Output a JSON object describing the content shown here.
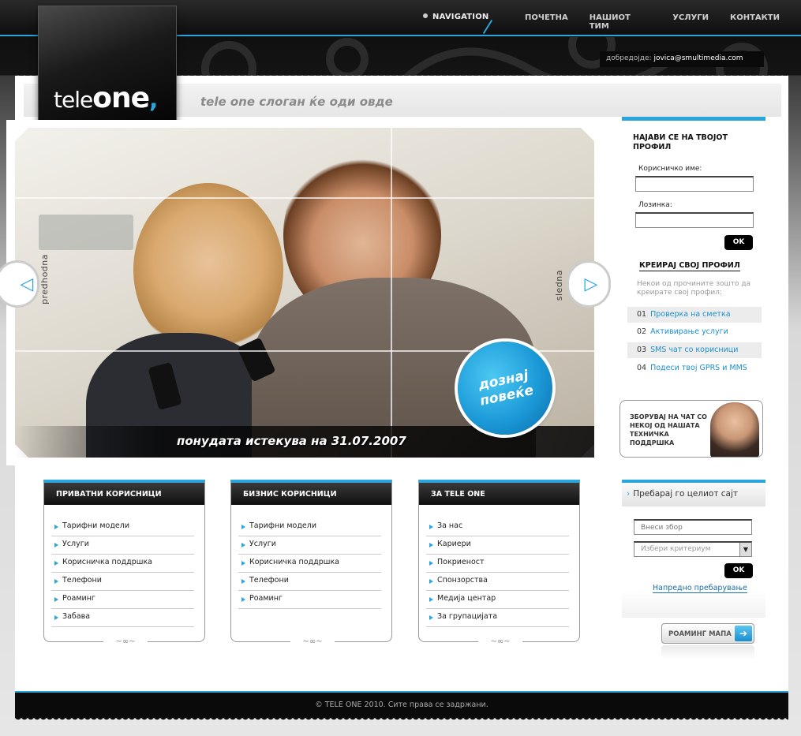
{
  "header": {
    "nav_tag": "NAVIGATION",
    "nav_items": [
      "ПОЧЕТНА",
      "НАШИОТ ТИМ",
      "УСЛУГИ",
      "КОНТАКТИ"
    ],
    "welcome_label": "добредојде:",
    "welcome_user": "jovica@smultimedia.com"
  },
  "logo": {
    "prefix": "tele",
    "main": "one",
    "comma": ","
  },
  "slogan": "tele one слоган ќе оди овде",
  "slider": {
    "prev_label": "predhodna",
    "next_label": "sledna",
    "caption": "понудата истекува на 31.07.2007",
    "badge_line1": "дознај",
    "badge_line2": "повеќе"
  },
  "login": {
    "title": "НАЈАВИ СЕ НА ТВОЈОТ ПРОФИЛ",
    "username_label": "Корисничко име:",
    "password_label": "Лозинка:",
    "ok_label": "OK",
    "create_label": "КРЕИРАЈ СВОЈ ПРОФИЛ",
    "reasons_intro": "Некои од прочините зошто да креирате свој профил:",
    "reasons": [
      {
        "num": "01",
        "text": "Проверка на сметка"
      },
      {
        "num": "02",
        "text": "Активирање услуги"
      },
      {
        "num": "03",
        "text": "SMS чат со корисници"
      },
      {
        "num": "04",
        "text": "Подеси твој GPRS и MMS"
      }
    ]
  },
  "chat": {
    "text": "ЗБОРУВАЈ НА ЧАТ СО НЕКОЈ ОД НАШАТА ТЕХНИЧКА ПОДДРШКА"
  },
  "columns": [
    {
      "title": "ПРИВАТНИ КОРИСНИЦИ",
      "items": [
        "Тарифни модели",
        "Услуги",
        "Корисничка поддршка",
        "Телефони",
        "Роаминг",
        "Забава"
      ]
    },
    {
      "title": "БИЗНИС КОРИСНИЦИ",
      "items": [
        "Тарифни модели",
        "Услуги",
        "Корисничка поддршка",
        "Телефони",
        "Роаминг"
      ]
    },
    {
      "title": "ЗА TELE ONE",
      "items": [
        "За нас",
        "Кариери",
        "Покриеност",
        "Спонзорства",
        "Медија центар",
        "За групацијата"
      ]
    }
  ],
  "search": {
    "title": "Пребарај го целиот сајт",
    "placeholder": "Внеси збор",
    "criteria": "Избери критериум",
    "ok_label": "OK",
    "advanced": "Напредно пребарување"
  },
  "roaming": {
    "label": "РОАМИНГ МАПА"
  },
  "footer": {
    "copyright": "© TELE ONE 2010. Сите права се задржани."
  },
  "colors": {
    "accent": "#2aa6dd",
    "dark": "#0a0a0a"
  }
}
